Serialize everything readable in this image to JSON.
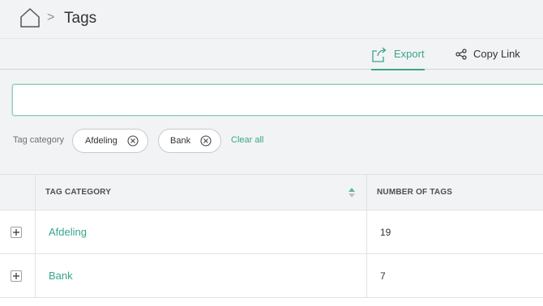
{
  "breadcrumb": {
    "home_icon": "home-icon",
    "separator": ">",
    "title": "Tags"
  },
  "toolbar": {
    "export": {
      "label": "Export",
      "icon": "export-icon",
      "active": true
    },
    "copy_link": {
      "label": "Copy Link",
      "icon": "share-icon"
    }
  },
  "search": {
    "value": "",
    "placeholder": ""
  },
  "filters": {
    "label": "Tag category",
    "chips": [
      {
        "label": "Afdeling",
        "remove_icon": "close-circle-icon"
      },
      {
        "label": "Bank",
        "remove_icon": "close-circle-icon"
      }
    ],
    "clear_all": "Clear all"
  },
  "table": {
    "columns": [
      {
        "label": "TAG CATEGORY",
        "sortable": true,
        "sort_icon": "sort-icon"
      },
      {
        "label": "NUMBER OF TAGS"
      }
    ],
    "rows": [
      {
        "category": "Afdeling",
        "count": "19",
        "expand_icon": "plus-icon"
      },
      {
        "category": "Bank",
        "count": "7",
        "expand_icon": "plus-icon"
      }
    ]
  },
  "colors": {
    "accent": "#3aa58a",
    "background": "#f2f3f5",
    "border": "#dfe2e5"
  }
}
